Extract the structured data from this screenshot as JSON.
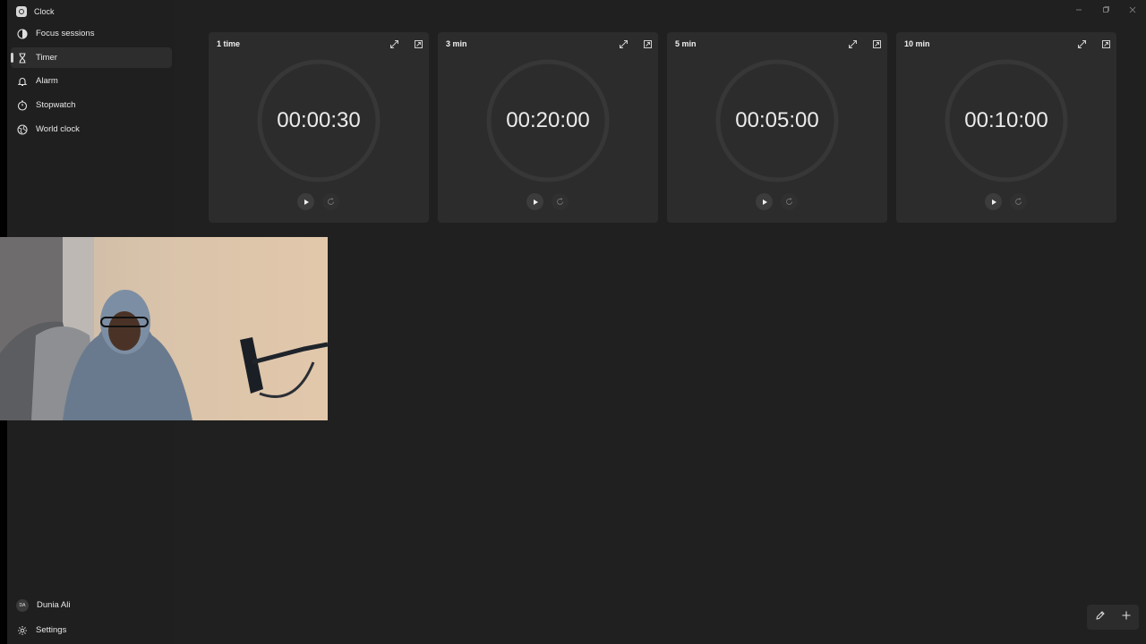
{
  "app": {
    "title": "Clock"
  },
  "sidebar": {
    "items": [
      {
        "id": "focus",
        "label": "Focus sessions",
        "icon": "focus-icon"
      },
      {
        "id": "timer",
        "label": "Timer",
        "icon": "hourglass-icon",
        "selected": true
      },
      {
        "id": "alarm",
        "label": "Alarm",
        "icon": "bell-icon"
      },
      {
        "id": "stopwatch",
        "label": "Stopwatch",
        "icon": "stopwatch-icon"
      },
      {
        "id": "worldclock",
        "label": "World clock",
        "icon": "globe-icon"
      }
    ],
    "user": {
      "initials": "DA",
      "name": "Dunia Ali"
    },
    "settings_label": "Settings"
  },
  "timers": [
    {
      "name": "1 time",
      "time": "00:00:30"
    },
    {
      "name": "3 min",
      "time": "00:20:00"
    },
    {
      "name": "5 min",
      "time": "00:05:00"
    },
    {
      "name": "10 min",
      "time": "00:10:00"
    }
  ],
  "colors": {
    "background": "#202020",
    "sidebar": "#1f1f1f",
    "card": "#2c2c2c",
    "ring": "#373737",
    "text": "#ebebeb"
  },
  "icons": {
    "card_expand": "expand-icon",
    "card_keep_on_top": "keep-on-top-icon",
    "play": "play-icon",
    "reset": "reset-icon",
    "edit": "pencil-icon",
    "add": "plus-icon",
    "minimize": "minimize-icon",
    "maximize": "maximize-icon",
    "close": "close-icon"
  }
}
